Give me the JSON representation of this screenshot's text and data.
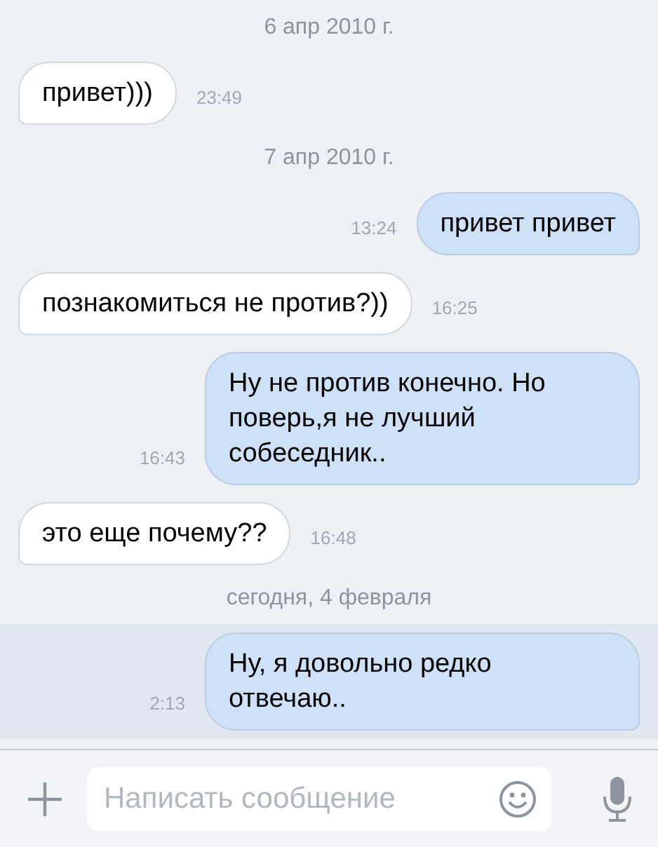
{
  "messages": [
    {
      "kind": "date",
      "text": "6 апр 2010 г."
    },
    {
      "kind": "incoming",
      "text": "привет)))",
      "time": "23:49",
      "unread": false
    },
    {
      "kind": "date",
      "text": "7 апр 2010 г."
    },
    {
      "kind": "outgoing",
      "text": "привет привет",
      "time": "13:24",
      "unread": false
    },
    {
      "kind": "incoming",
      "text": "познакомиться не против?))",
      "time": "16:25",
      "unread": false
    },
    {
      "kind": "outgoing",
      "text": "Ну не против конечно. Но поверь,я не лучший собеседник..",
      "time": "16:43",
      "unread": false
    },
    {
      "kind": "incoming",
      "text": "это еще почему??",
      "time": "16:48",
      "unread": false
    },
    {
      "kind": "date",
      "text": "сегодня, 4 февраля"
    },
    {
      "kind": "outgoing",
      "text": "Ну, я довольно редко отвечаю..",
      "time": "2:13",
      "unread": true
    }
  ],
  "composer": {
    "placeholder": "Написать сообщение"
  }
}
